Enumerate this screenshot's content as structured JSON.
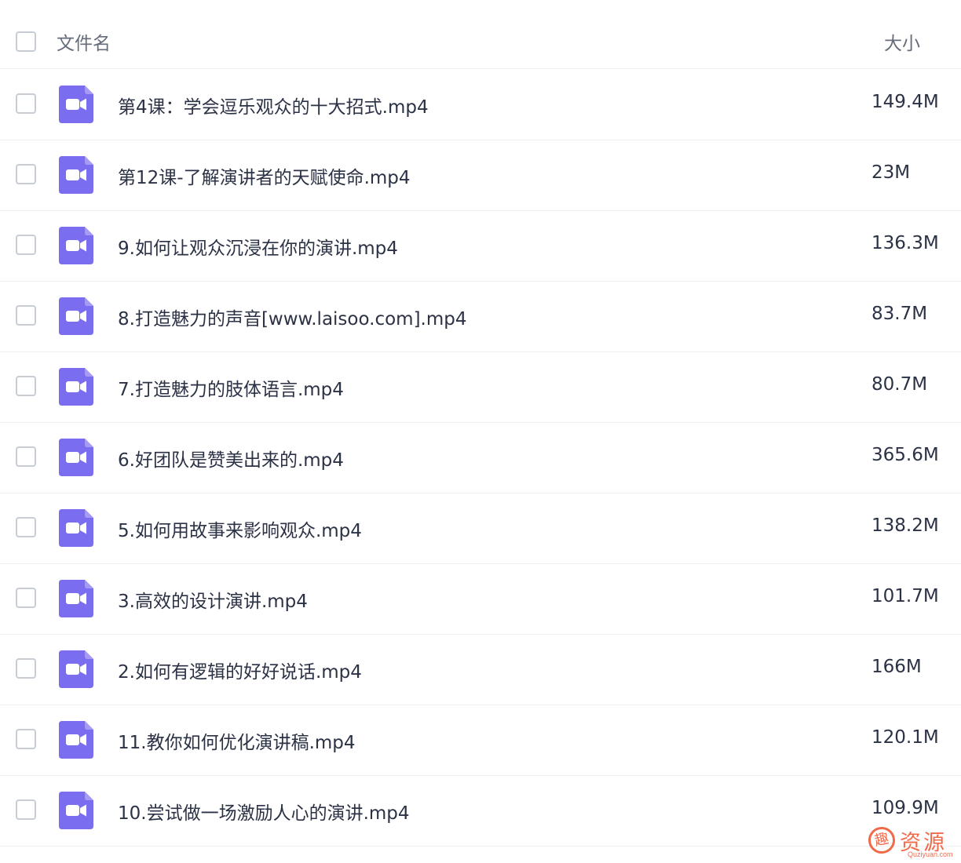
{
  "header": {
    "name_label": "文件名",
    "size_label": "大小"
  },
  "files": [
    {
      "name": "第4课：学会逗乐观众的十大招式.mp4",
      "size": "149.4M"
    },
    {
      "name": "第12课-了解演讲者的天赋使命.mp4",
      "size": "23M"
    },
    {
      "name": "9.如何让观众沉浸在你的演讲.mp4",
      "size": "136.3M"
    },
    {
      "name": "8.打造魅力的声音[www.laisoo.com].mp4",
      "size": "83.7M"
    },
    {
      "name": "7.打造魅力的肢体语言.mp4",
      "size": "80.7M"
    },
    {
      "name": "6.好团队是赞美出来的.mp4",
      "size": "365.6M"
    },
    {
      "name": "5.如何用故事来影响观众.mp4",
      "size": "138.2M"
    },
    {
      "name": "3.高效的设计演讲.mp4",
      "size": "101.7M"
    },
    {
      "name": "2.如何有逻辑的好好说话.mp4",
      "size": "166M"
    },
    {
      "name": "11.教你如何优化演讲稿.mp4",
      "size": "120.1M"
    },
    {
      "name": "10.尝试做一场激励人心的演讲.mp4",
      "size": "109.9M"
    }
  ],
  "file_icon": {
    "name": "video-file-icon",
    "color": "#7b6df0"
  },
  "watermark": {
    "logo_char": "趣",
    "text": "资源",
    "sub": "Quziyuan.com",
    "color": "#f06a4a"
  }
}
